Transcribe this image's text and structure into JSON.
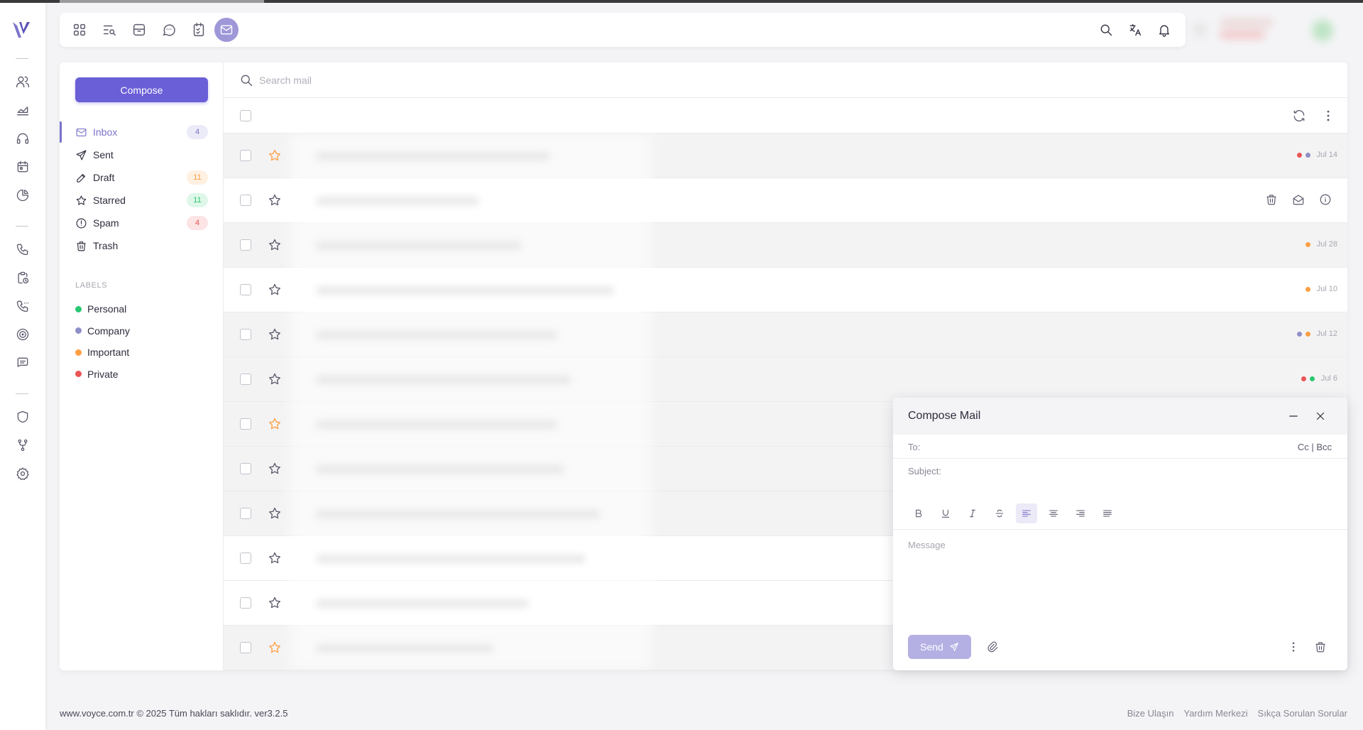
{
  "compose_button": "Compose",
  "folders": [
    {
      "name": "inbox",
      "label": "Inbox",
      "count": "4",
      "active": true
    },
    {
      "name": "sent",
      "label": "Sent",
      "count": ""
    },
    {
      "name": "draft",
      "label": "Draft",
      "count": "11"
    },
    {
      "name": "starred",
      "label": "Starred",
      "count": "11"
    },
    {
      "name": "spam",
      "label": "Spam",
      "count": "4"
    },
    {
      "name": "trash",
      "label": "Trash",
      "count": ""
    }
  ],
  "labels_title": "LABELS",
  "labels": [
    {
      "label": "Personal",
      "color": "#28c76f"
    },
    {
      "label": "Company",
      "color": "#8f8fc7"
    },
    {
      "label": "Important",
      "color": "#ff9f43"
    },
    {
      "label": "Private",
      "color": "#ea5455"
    }
  ],
  "search": {
    "placeholder": "Search mail"
  },
  "mail_rows": [
    {
      "starred": true,
      "date": "Jul 14",
      "dots": [
        "#ea5455",
        "#8f8fc7"
      ]
    },
    {
      "starred": false,
      "date": "",
      "dots": [],
      "hovered": true
    },
    {
      "starred": false,
      "date": "Jul 28",
      "dots": [
        "#ff9f43"
      ]
    },
    {
      "starred": false,
      "date": "Jul 10",
      "dots": [
        "#ff9f43"
      ]
    },
    {
      "starred": false,
      "date": "Jul 12",
      "dots": [
        "#8f8fc7",
        "#ff9f43"
      ]
    },
    {
      "starred": false,
      "date": "Jul 6",
      "dots": [
        "#ea5455",
        "#28c76f"
      ]
    },
    {
      "starred": true,
      "date": "",
      "dots": []
    },
    {
      "starred": false,
      "date": "",
      "dots": []
    },
    {
      "starred": false,
      "date": "",
      "dots": []
    },
    {
      "starred": false,
      "date": "",
      "dots": []
    },
    {
      "starred": false,
      "date": "",
      "dots": []
    },
    {
      "starred": true,
      "date": "",
      "dots": []
    }
  ],
  "compose": {
    "title": "Compose Mail",
    "to_label": "To:",
    "cc_bcc": "Cc | Bcc",
    "subject_label": "Subject:",
    "message_placeholder": "Message",
    "send_label": "Send"
  },
  "footer": {
    "copyright": "www.voyce.com.tr © 2025 Tüm hakları saklıdır. ver3.2.5",
    "links": [
      "Bize Ulaşın",
      "Yardım Merkezi",
      "Sıkça Sorulan Sorular"
    ]
  },
  "colors": {
    "primary": "#6a5fd6",
    "active": "#7a73c9",
    "star": "#ff9f43"
  }
}
